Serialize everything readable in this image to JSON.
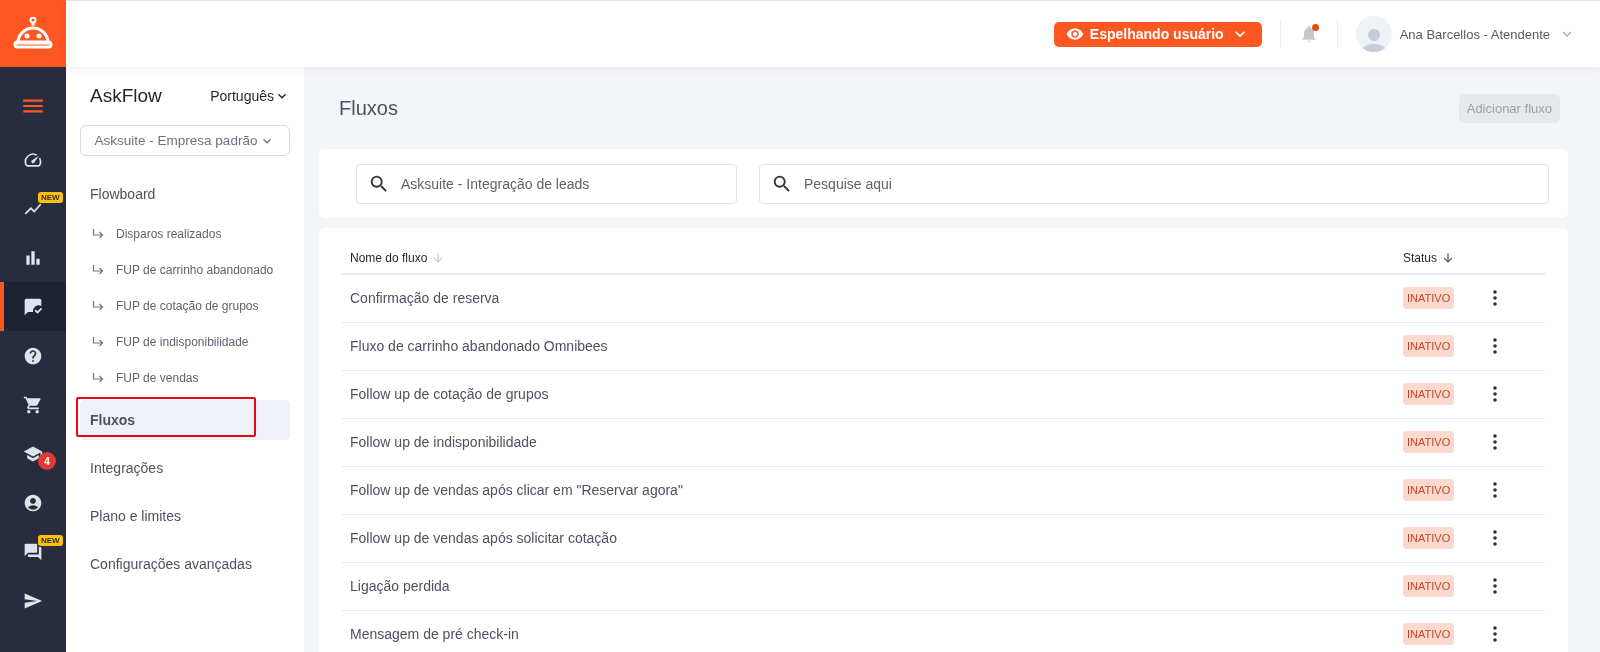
{
  "header": {
    "mirror_button": "Espelhando usuário",
    "notifications": {
      "unread": true
    },
    "user": {
      "name": "Ana Barcellos - Atendente"
    }
  },
  "rail": {
    "items": [
      {
        "selected": false
      },
      {
        "selected": false
      },
      {
        "selected": false,
        "badge": {
          "kind": "new",
          "text": "NEW"
        }
      },
      {
        "selected": false
      },
      {
        "selected": true
      },
      {
        "selected": false
      },
      {
        "selected": false
      },
      {
        "selected": false,
        "badge": {
          "kind": "count",
          "text": "4"
        }
      },
      {
        "selected": false
      },
      {
        "selected": false,
        "badge": {
          "kind": "new",
          "text": "NEW"
        }
      },
      {
        "selected": false
      }
    ]
  },
  "sidebar": {
    "title": "AskFlow",
    "language": "Português",
    "company": "Asksuite - Empresa padrão",
    "items": [
      {
        "label": "Flowboard",
        "selected": false,
        "annotated": false,
        "children": [
          {
            "label": "Disparos realizados",
            "selected": false
          },
          {
            "label": "FUP de carrinho abandonado",
            "selected": false
          },
          {
            "label": "FUP de cotação de grupos",
            "selected": false
          },
          {
            "label": "FUP de indisponibilidade",
            "selected": false
          },
          {
            "label": "FUP de vendas",
            "selected": false
          }
        ]
      },
      {
        "label": "Fluxos",
        "selected": true,
        "annotated": true
      },
      {
        "label": "Integrações",
        "selected": false,
        "annotated": false
      },
      {
        "label": "Plano e limites",
        "selected": false,
        "annotated": false
      },
      {
        "label": "Configurações avançadas",
        "selected": false,
        "annotated": false
      }
    ]
  },
  "main": {
    "title": "Fluxos",
    "add_button": {
      "label": "Adicionar fluxo",
      "disabled": true
    },
    "filters": [
      {
        "value": "Asksuite - Integração de leads"
      },
      {
        "placeholder": "Pesquise aqui"
      }
    ],
    "table": {
      "columns": [
        {
          "label": "Nome do fluxo",
          "sorted": false
        },
        {
          "label": "Status",
          "sorted": true
        }
      ],
      "rows": [
        {
          "name": "Confirmação de reserva",
          "status": "INATIVO",
          "active": false
        },
        {
          "name": "Fluxo de carrinho abandonado Omnibees",
          "status": "INATIVO",
          "active": false
        },
        {
          "name": "Follow up de cotação de grupos",
          "status": "INATIVO",
          "active": false
        },
        {
          "name": "Follow up de indisponibilidade",
          "status": "INATIVO",
          "active": false
        },
        {
          "name": "Follow up de vendas após clicar em \"Reservar agora\"",
          "status": "INATIVO",
          "active": false
        },
        {
          "name": "Follow up de vendas após solicitar cotação",
          "status": "INATIVO",
          "active": false
        },
        {
          "name": "Ligação perdida",
          "status": "INATIVO",
          "active": false
        },
        {
          "name": "Mensagem de pré check-in",
          "status": "INATIVO",
          "active": false
        }
      ]
    }
  }
}
